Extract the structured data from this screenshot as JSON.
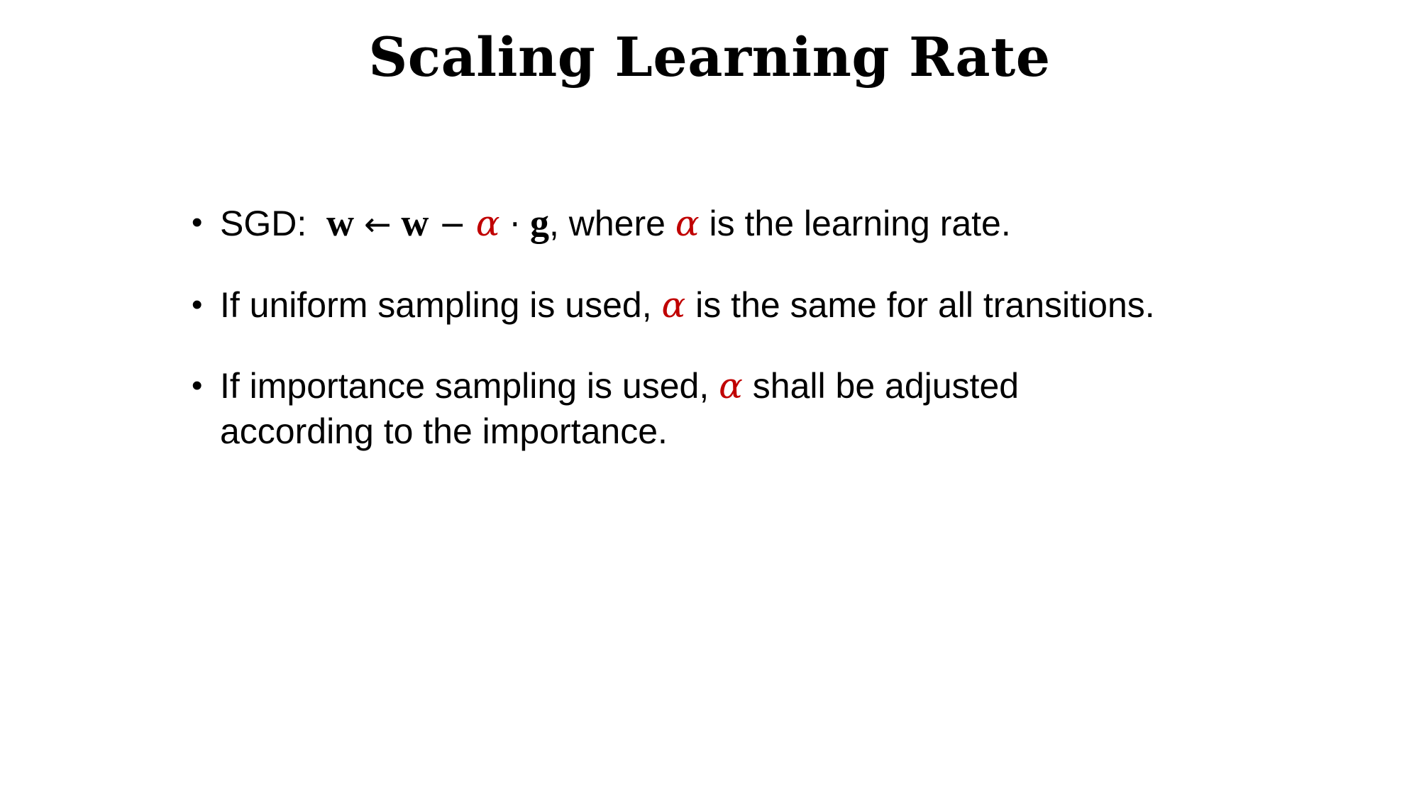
{
  "title": "Scaling Learning Rate",
  "accent_color": "#c00000",
  "bullets": [
    {
      "label": "SGD:",
      "formula": {
        "w1": "w",
        "arrow": "←",
        "w2": "w",
        "minus": "−",
        "alpha": "α",
        "dot": "·",
        "g": "g"
      },
      "text_mid": ", where",
      "alpha": "α",
      "text_end": "is the learning rate."
    },
    {
      "text_start": "If uniform sampling is used,",
      "alpha": "α",
      "text_end": "is the same for all transitions."
    },
    {
      "text_start": "If importance sampling is used,",
      "alpha": "α",
      "text_end": "shall be adjusted",
      "text_line2": "according to the importance."
    }
  ]
}
